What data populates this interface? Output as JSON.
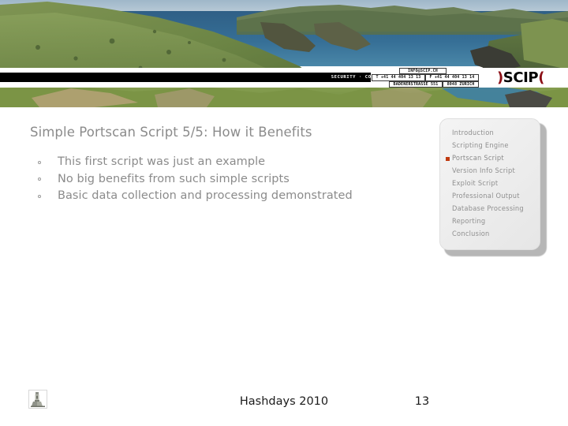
{
  "header": {
    "image_alt": "coastal-landscape-photo",
    "tagline": "SECURITY · CONSULTING · INFORMATION · PROCESS",
    "contact": {
      "email": "INFO@SCIP.CH",
      "tel": "T +41 44 404 13 13",
      "fax": "F +41 44 404 13 14",
      "street": "BADENERSTRASSE 551",
      "city": "8048 ZÜRICH"
    },
    "logo": {
      "left_paren": ")",
      "name": "SCIP",
      "right_paren": "(",
      "paren_color": "#8c1017",
      "text_color": "#000000"
    }
  },
  "slide": {
    "title": "Simple Portscan Script 5/5: How it Benefits",
    "title_color": "#8b8b8b",
    "bullets": [
      "This first script was just an example",
      "No big benefits from such simple scripts",
      "Basic data collection and processing demonstrated"
    ]
  },
  "nav": {
    "current_marker_color": "#c03a10",
    "items": [
      {
        "label": "Introduction",
        "current": false
      },
      {
        "label": "Scripting Engine",
        "current": false
      },
      {
        "label": "Portscan Script",
        "current": true
      },
      {
        "label": "Version Info Script",
        "current": false
      },
      {
        "label": "Exploit Script",
        "current": false
      },
      {
        "label": "Professional Output",
        "current": false
      },
      {
        "label": "Database Processing",
        "current": false
      },
      {
        "label": "Reporting",
        "current": false
      },
      {
        "label": "Conclusion",
        "current": false
      }
    ]
  },
  "footer": {
    "logo_alt": "lighthouse-thumbnail",
    "event": "Hashdays 2010",
    "page_number": "13"
  }
}
